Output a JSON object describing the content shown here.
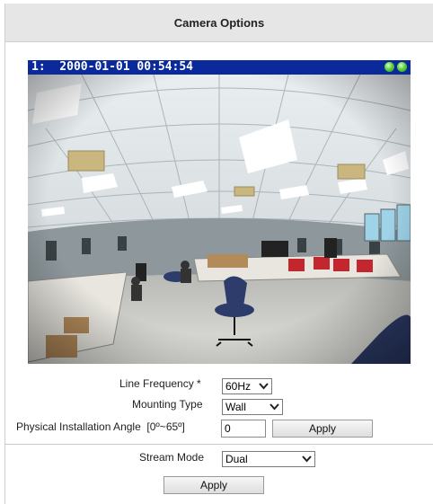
{
  "header": {
    "title": "Camera Options"
  },
  "viewer": {
    "osd_text": "1:  2000-01-01 00:54:54",
    "status_icons": [
      "green-led-icon",
      "green-led-icon"
    ]
  },
  "form": {
    "line_frequency": {
      "label": "Line Frequency *",
      "value": "60Hz"
    },
    "mounting_type": {
      "label": "Mounting Type",
      "value": "Wall"
    },
    "installation_angle": {
      "label": "Physical Installation Angle  [0º~65º]",
      "value": "0",
      "apply_label": "Apply"
    },
    "stream_mode": {
      "label": "Stream Mode",
      "value": "Dual"
    },
    "apply_label": "Apply"
  },
  "colors": {
    "osd_bar": "#0a2a9c",
    "header_bg": "#e6e6e6",
    "led": "#5fd23a"
  }
}
